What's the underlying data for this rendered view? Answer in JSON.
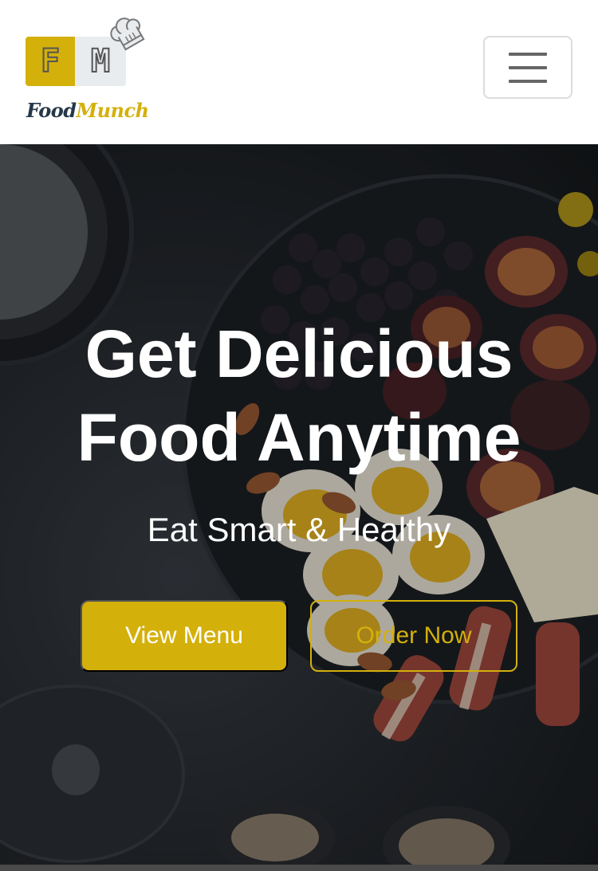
{
  "header": {
    "logo": {
      "letters": [
        "F",
        "M"
      ],
      "brand_part1": "Food",
      "brand_part2": "Munch",
      "icon": "chef-hat-icon"
    },
    "menu_toggle": {
      "icon": "hamburger-menu-icon"
    }
  },
  "hero": {
    "title_line1": "Get Delicious",
    "title_line2": "Food Anytime",
    "subtitle": "Eat Smart & Healthy",
    "buttons": {
      "view_menu": "View Menu",
      "order_now": "Order Now"
    }
  },
  "colors": {
    "accent": "#d4b00b",
    "brand_dark": "#26374a",
    "logo_grey": "#e9ecef"
  }
}
